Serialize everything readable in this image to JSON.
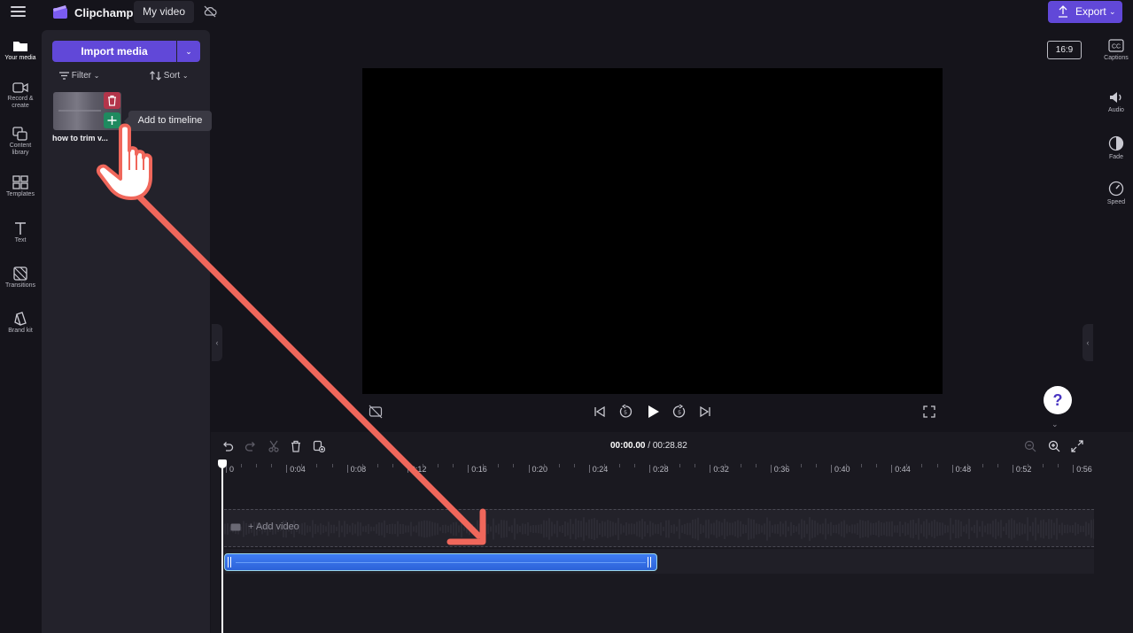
{
  "app": {
    "brand": "Clipchamp",
    "project_title": "My video",
    "export_label": "Export"
  },
  "left_rail": [
    {
      "label": "Your media",
      "icon": "folder-icon",
      "active": true
    },
    {
      "label": "Record & create",
      "icon": "camera-icon"
    },
    {
      "label": "Content library",
      "icon": "library-icon"
    },
    {
      "label": "Templates",
      "icon": "templates-icon"
    },
    {
      "label": "Text",
      "icon": "text-icon"
    },
    {
      "label": "Transitions",
      "icon": "transitions-icon"
    },
    {
      "label": "Brand kit",
      "icon": "brand-kit-icon"
    }
  ],
  "media_panel": {
    "import_label": "Import media",
    "filter_label": "Filter",
    "sort_label": "Sort",
    "items": [
      {
        "name": "how to trim v..."
      }
    ],
    "tooltip": "Add to timeline"
  },
  "preview": {
    "aspect_ratio": "16:9",
    "help_label": "?"
  },
  "right_rail": [
    {
      "label": "Captions",
      "icon": "captions-icon"
    },
    {
      "label": "Audio",
      "icon": "speaker-icon"
    },
    {
      "label": "Fade",
      "icon": "fade-icon"
    },
    {
      "label": "Speed",
      "icon": "speedometer-icon"
    }
  ],
  "timeline": {
    "current_time": "00:00.00",
    "separator": "/",
    "total_time": "00:28.82",
    "ruler": [
      "0",
      "0:04",
      "0:08",
      "0:12",
      "0:16",
      "0:20",
      "0:24",
      "0:28",
      "0:32",
      "0:36",
      "0:40",
      "0:44",
      "0:48",
      "0:52",
      "0:56"
    ],
    "add_video_label": "+ Add video"
  },
  "colors": {
    "accent": "#6148d8",
    "delete": "#b3354a",
    "add": "#1f8a5f",
    "audio_clip": "#3f7cf2",
    "annotation_arrow": "#f0675b"
  }
}
